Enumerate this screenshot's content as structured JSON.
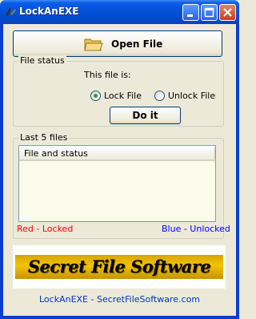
{
  "window": {
    "title": "LockAnEXE"
  },
  "toolbar": {
    "open_label": "Open File"
  },
  "file_status": {
    "legend": "File status",
    "this_file_label": "This file is:",
    "lock_label": "Lock File",
    "unlock_label": "Unlock File",
    "selected": "lock",
    "do_it_label": "Do it"
  },
  "recent": {
    "legend": "Last 5 files",
    "column_header": "File and status",
    "rows": []
  },
  "legend_keys": {
    "locked": "Red - Locked",
    "unlocked": "Blue - Unlocked"
  },
  "banner": {
    "text": "Secret File Software"
  },
  "footer": {
    "text": "LockAnEXE - SecretFileSoftware.com"
  },
  "colors": {
    "locked": "#ff0000",
    "unlocked": "#0000ff",
    "link": "#0033cc",
    "titlebar": "#0450d8"
  }
}
